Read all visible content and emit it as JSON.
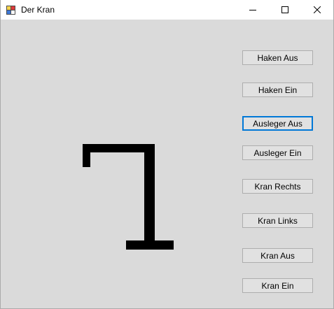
{
  "window": {
    "title": "Der Kran",
    "app_icon": "winforms-app-icon",
    "controls": {
      "minimize_icon": "minimize-icon",
      "maximize_icon": "maximize-icon",
      "close_icon": "close-icon"
    }
  },
  "buttons": [
    {
      "id": "haken-aus",
      "label": "Haken Aus",
      "focused": false
    },
    {
      "id": "haken-ein",
      "label": "Haken Ein",
      "focused": false
    },
    {
      "id": "ausleger-aus",
      "label": "Ausleger Aus",
      "focused": true
    },
    {
      "id": "ausleger-ein",
      "label": "Ausleger Ein",
      "focused": false
    },
    {
      "id": "kran-rechts",
      "label": "Kran Rechts",
      "focused": false
    },
    {
      "id": "kran-links",
      "label": "Kran Links",
      "focused": false
    },
    {
      "id": "kran-aus",
      "label": "Kran Aus",
      "focused": false
    },
    {
      "id": "kran-ein",
      "label": "Kran Ein",
      "focused": false
    }
  ],
  "colors": {
    "form_background": "#dadada",
    "crane": "#000000",
    "button_face": "#e1e1e1",
    "button_border": "#adadad",
    "focus_border": "#0078d7",
    "titlebar": "#ffffff"
  }
}
